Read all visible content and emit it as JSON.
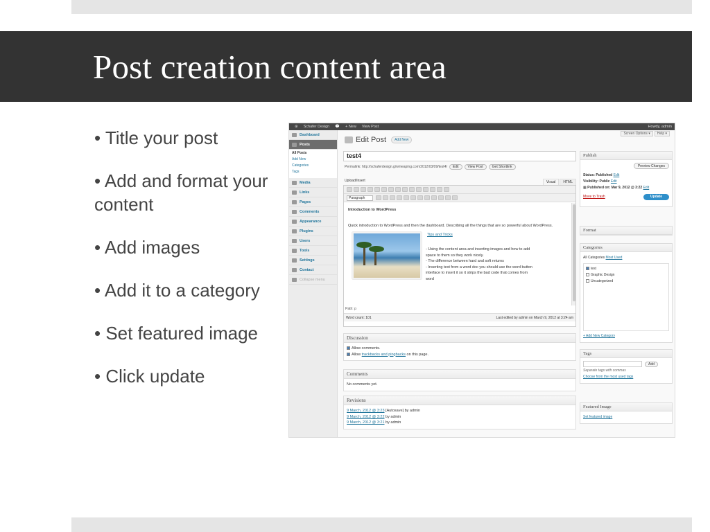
{
  "slide": {
    "title": "Post creation content area",
    "bullets": [
      "• Title your post",
      "• Add and format your content",
      "• Add images",
      "• Add it to a category",
      "• Set featured image",
      "• Click update"
    ]
  },
  "wp": {
    "adminbar": {
      "site": "Schafer Design",
      "new": "+ New",
      "view": "View Post",
      "howdy": "Howdy, admin"
    },
    "screen_options": "Screen Options ▾",
    "help": "Help ▾",
    "menu": {
      "dashboard": "Dashboard",
      "posts": "Posts",
      "posts_sub": [
        "All Posts",
        "Add New",
        "Categories",
        "Tags"
      ],
      "others": [
        "Media",
        "Links",
        "Pages",
        "Comments",
        "Appearance",
        "Plugins",
        "Users",
        "Tools",
        "Settings",
        "Contact"
      ],
      "collapse": "Collapse menu"
    },
    "edit_post": {
      "heading": "Edit Post",
      "add_new": "Add New"
    },
    "post_title": "test4",
    "permalink": {
      "label": "Permalink: http://schaferdesign.g/wmeaping.com/2012/03/09/test4/",
      "edit": "Edit",
      "view": "View Post",
      "shortlink": "Get Shortlink"
    },
    "upload_insert": "Upload/Insert",
    "editor_tabs": {
      "visual": "Visual",
      "html": "HTML"
    },
    "format_select": "Paragraph",
    "content": {
      "heading": "Introduction to WordPress",
      "intro": "Quick introduction to WordPress and then the dashboard. Describing all the things that are so powerful about WordPress.",
      "link": "Tips and Tricks",
      "items": [
        "- Using the content area and inserting images and how to add space to them so they work nicely.",
        "- The difference between hard and soft returns",
        "- Inserting text from a word doc you should use the word button interface to insert it so it strips the bad code that comes from word"
      ]
    },
    "path": "Path: p",
    "word_count": "Word count: 101",
    "last_edited": "Last edited by admin on March 9, 2012 at 3:24 am",
    "discussion": {
      "title": "Discussion",
      "allow_comments": "Allow comments.",
      "allow_prefix": "Allow",
      "allow_link": "trackbacks and pingbacks",
      "allow_suffix": "on this page."
    },
    "comments": {
      "title": "Comments",
      "text": "No comments yet."
    },
    "revisions": {
      "title": "Revisions",
      "items": [
        {
          "link": "9 March, 2012 @ 3:23",
          "text": "[Autosave] by admin"
        },
        {
          "link": "9 March, 2012 @ 3:22",
          "text": "by admin"
        },
        {
          "link": "9 March, 2012 @ 3:21",
          "text": "by admin"
        }
      ]
    },
    "publish": {
      "title": "Publish",
      "preview": "Preview Changes",
      "status": "Status: Published",
      "visibility": "Visibility: Public",
      "published_on": "Published on: Mar 9, 2012 @ 3:22",
      "edit": "Edit",
      "trash": "Move to Trash",
      "update": "Update"
    },
    "format": {
      "title": "Format"
    },
    "categories": {
      "title": "Categories",
      "tab_all": "All Categories",
      "tab_used": "Most Used",
      "items": [
        "test",
        "Graphic Design",
        "Uncategorized"
      ],
      "add_new": "+ Add New Category"
    },
    "tags": {
      "title": "Tags",
      "add": "Add",
      "hint": "Separate tags with commas",
      "choose": "Choose from the most used tags"
    },
    "featured": {
      "title": "Featured Image",
      "link": "Set featured image"
    }
  }
}
